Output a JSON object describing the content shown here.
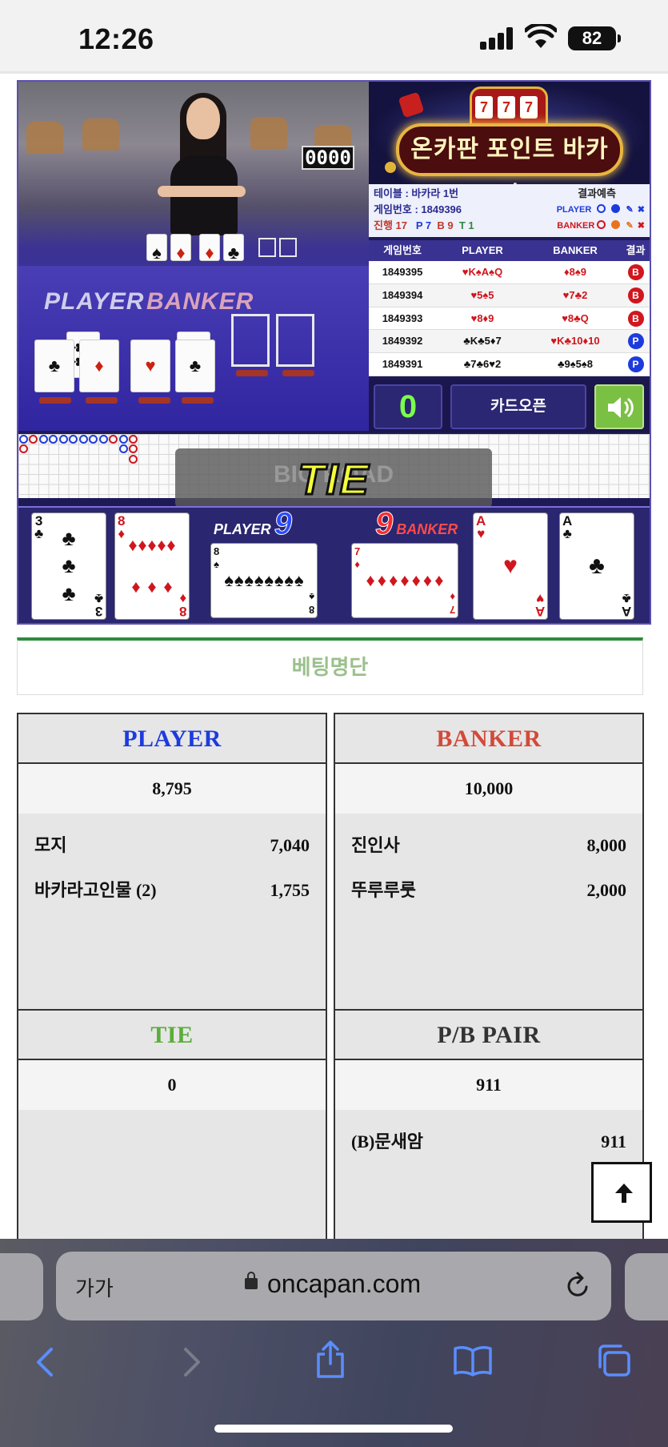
{
  "status": {
    "time": "12:26",
    "battery": "82"
  },
  "video": {
    "counter": "0000",
    "player_label": "PLAYER",
    "banker_label": "BANKER"
  },
  "title_panel": {
    "slot": [
      "7",
      "7",
      "7"
    ],
    "marquee": "온카판 포인트 바카라"
  },
  "info": {
    "table": "테이블 : 바카라 1번",
    "game_no": "게임번호 : 1849396",
    "progress": "진행 17",
    "p_count": "P 7",
    "b_count": "B 9",
    "t_count": "T 1",
    "predict": "결과예측",
    "player": "PLAYER",
    "banker": "BANKER"
  },
  "history": {
    "headers": [
      "게임번호",
      "PLAYER",
      "BANKER",
      "결과"
    ],
    "rows": [
      {
        "no": "1849395",
        "player": "♥K♠A♠Q",
        "banker": "♦8♠9",
        "result": "B"
      },
      {
        "no": "1849394",
        "player": "♥5♠5",
        "banker": "♥7♣2",
        "result": "B"
      },
      {
        "no": "1849393",
        "player": "♥8♦9",
        "banker": "♥8♣Q",
        "result": "B"
      },
      {
        "no": "1849392",
        "player": "♣K♣5♦7",
        "banker": "♥K♣10♦10",
        "result": "P"
      },
      {
        "no": "1849391",
        "player": "♣7♣6♥2",
        "banker": "♣9♠5♠8",
        "result": "P"
      }
    ]
  },
  "controls": {
    "count": "0",
    "open_label": "카드오픈"
  },
  "overlay": {
    "ghost": "BIG ROAD",
    "result": "TIE"
  },
  "result_strip": {
    "player_label": "PLAYER",
    "player_score": "9",
    "banker_label": "BANKER",
    "banker_score": "9"
  },
  "bet_list_title": "베팅명단",
  "bets": {
    "player": {
      "title": "PLAYER",
      "total": "8,795",
      "entries": [
        {
          "name": "모지",
          "amount": "7,040"
        },
        {
          "name": "바카라고인물 (2)",
          "amount": "1,755"
        }
      ]
    },
    "banker": {
      "title": "BANKER",
      "total": "10,000",
      "entries": [
        {
          "name": "진인사",
          "amount": "8,000"
        },
        {
          "name": "뚜루루룻",
          "amount": "2,000"
        }
      ]
    },
    "tie": {
      "title": "TIE",
      "total": "0",
      "entries": []
    },
    "pair": {
      "title": "P/B PAIR",
      "total": "911",
      "entries": [
        {
          "name": "(B)문새암",
          "amount": "911"
        }
      ]
    }
  },
  "browser": {
    "text_size": "가가",
    "url": "oncapan.com"
  },
  "colors": {
    "player_blue": "#1d3bdc",
    "banker_red": "#d24a3a",
    "tie_green": "#5aae3a",
    "accent_green": "#2e8b3e"
  }
}
